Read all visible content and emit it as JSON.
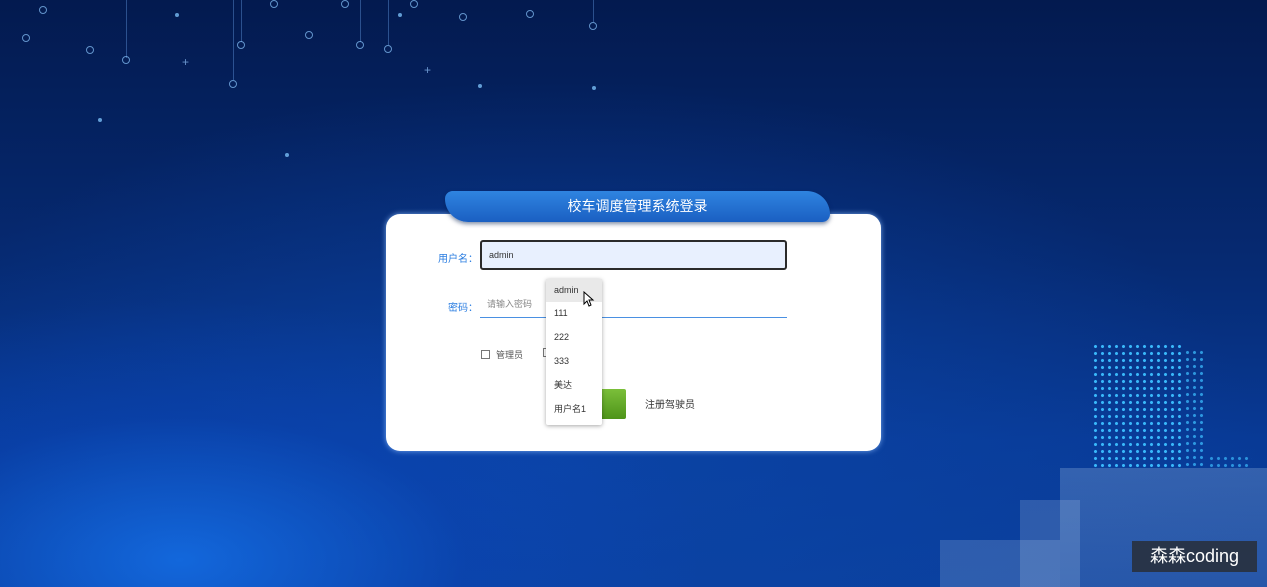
{
  "login": {
    "title": "校车调度管理系统登录",
    "username_label": "用户名：",
    "username_value": "admin",
    "password_label": "密码：",
    "password_placeholder": "请输入密码",
    "role_option_1": "管理员",
    "register_link": "注册驾驶员"
  },
  "autocomplete": {
    "items": [
      "admin",
      "111",
      "222",
      "333",
      "美达",
      "用户名1"
    ]
  },
  "watermark": "森森coding",
  "colors": {
    "accent_blue": "#2a7de1",
    "login_button_green": "#5fa626",
    "title_bar_blue": "#1f6ccf"
  }
}
